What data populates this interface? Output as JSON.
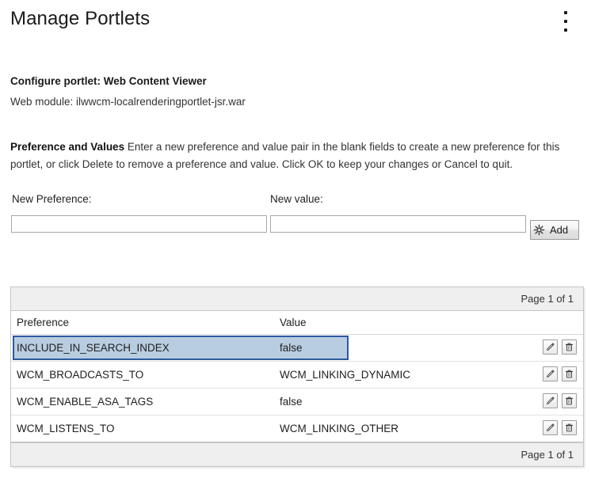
{
  "header": {
    "title": "Manage Portlets",
    "menu_icon": "kebab-menu-icon"
  },
  "info": {
    "configure_line": "Configure portlet: Web Content Viewer",
    "web_module_line": "Web module: ilwwcm-localrenderingportlet-jsr.war"
  },
  "description": {
    "bold_lead": "Preference and Values",
    "body": " Enter a new preference and value pair in the blank fields to create a new preference for this portlet, or click Delete to remove a preference and value. Click OK to keep your changes or Cancel to quit."
  },
  "form": {
    "new_preference_label": "New Preference:",
    "new_value_label": "New value:",
    "new_preference_value": "",
    "new_value_value": "",
    "new_preference_placeholder": "",
    "new_value_placeholder": "",
    "add_label": "Add",
    "add_icon": "star-burst-icon"
  },
  "table": {
    "top_page_indicator": "Page 1 of 1",
    "bottom_page_indicator": "Page 1 of 1",
    "columns": [
      "Preference",
      "Value"
    ],
    "rows": [
      {
        "preference": "INCLUDE_IN_SEARCH_INDEX",
        "value": "false",
        "selected": true,
        "edit_icon": "pencil-icon",
        "delete_icon": "trash-icon"
      },
      {
        "preference": "WCM_BROADCASTS_TO",
        "value": "WCM_LINKING_DYNAMIC",
        "selected": false,
        "edit_icon": "pencil-icon",
        "delete_icon": "trash-icon"
      },
      {
        "preference": "WCM_ENABLE_ASA_TAGS",
        "value": "false",
        "selected": false,
        "edit_icon": "pencil-icon",
        "delete_icon": "trash-icon"
      },
      {
        "preference": "WCM_LISTENS_TO",
        "value": "WCM_LINKING_OTHER",
        "selected": false,
        "edit_icon": "pencil-icon",
        "delete_icon": "trash-icon"
      }
    ]
  },
  "colors": {
    "selection_fill": "#b9cde1",
    "selection_border": "#2d5a9e",
    "bar_background": "#efefef",
    "table_border": "#c6c6c6"
  }
}
